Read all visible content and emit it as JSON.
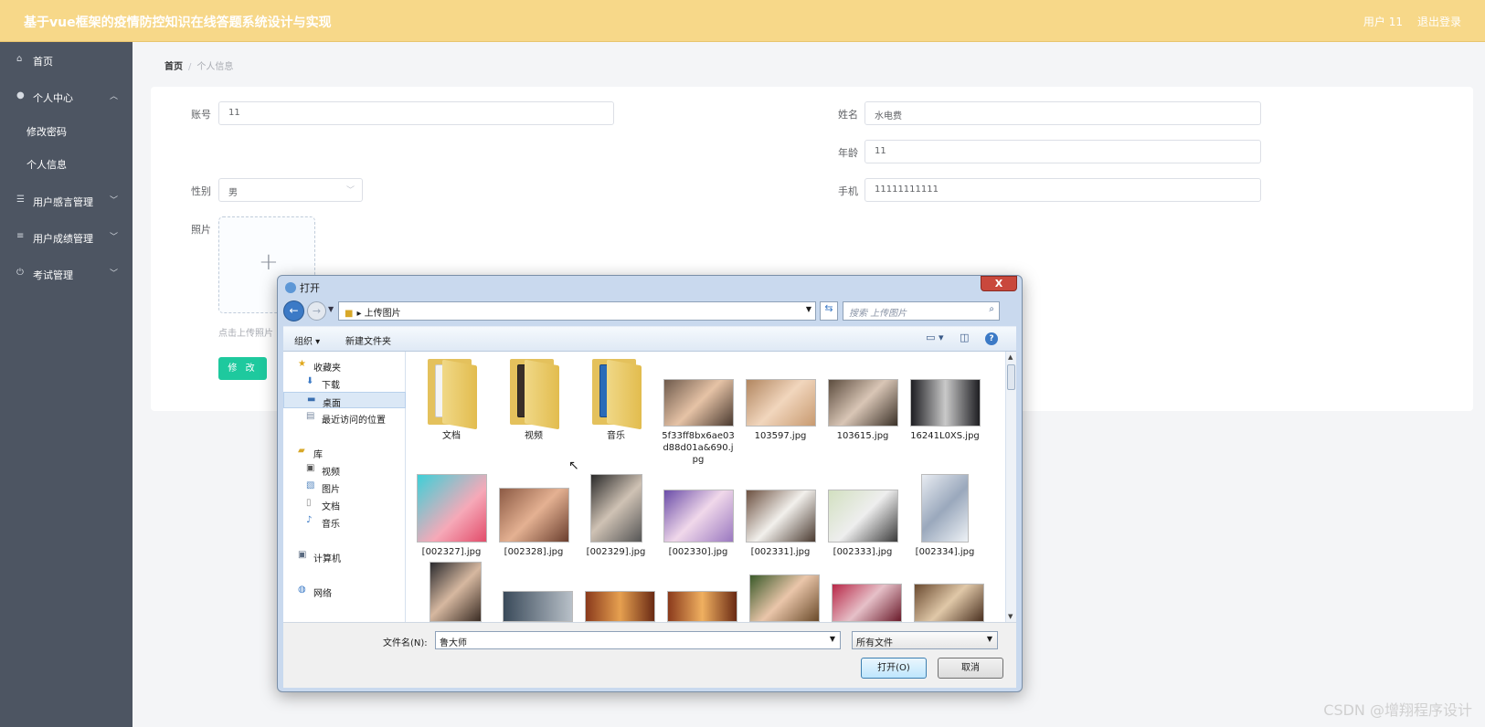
{
  "header": {
    "title": "基于vue框架的疫情防控知识在线答题系统设计与实现",
    "user": "用户 11",
    "logout": "退出登录",
    "bg_color": "#f7d889"
  },
  "sidebar": {
    "home": "首页",
    "personal_center": "个人中心",
    "change_password": "修改密码",
    "personal_info": "个人信息",
    "user_feedback": "用户感言管理",
    "user_scores": "用户成绩管理",
    "exam_mgmt": "考试管理"
  },
  "breadcrumb": {
    "home": "首页",
    "sep": "/",
    "current": "个人信息"
  },
  "form": {
    "account_label": "账号",
    "account_value": "11",
    "name_label": "姓名",
    "name_value": "水电费",
    "age_label": "年龄",
    "age_value": "11",
    "gender_label": "性别",
    "gender_value": "男",
    "phone_label": "手机",
    "phone_value": "11111111111",
    "photo_label": "照片",
    "upload_tip": "点击上传照片",
    "submit": "修 改",
    "accent": "#1ec99e"
  },
  "dialog": {
    "title": "打开",
    "close": "X",
    "address": "上传图片",
    "search_placeholder": "搜索 上传图片",
    "toolbar": {
      "organize": "组织 ▾",
      "new_folder": "新建文件夹"
    },
    "nav": {
      "favorites": "收藏夹",
      "downloads": "下载",
      "desktop": "桌面",
      "recent": "最近访问的位置",
      "libraries": "库",
      "videos": "视频",
      "pictures": "图片",
      "documents": "文档",
      "music": "音乐",
      "computer": "计算机",
      "network": "网络"
    },
    "files": [
      "文档",
      "视频",
      "音乐",
      "5f33ff8bx6ae03d88d01a&690.jpg",
      "103597.jpg",
      "103615.jpg",
      "16241L0XS.jpg",
      "[002327].jpg",
      "[002328].jpg",
      "[002329].jpg",
      "[002330].jpg",
      "[002331].jpg",
      "[002333].jpg",
      "[002334].jpg"
    ],
    "filename_label": "文件名(N):",
    "filename_value": "鲁大师",
    "filter": "所有文件",
    "open": "打开(O)",
    "cancel": "取消"
  },
  "watermark": "CSDN @增翔程序设计"
}
